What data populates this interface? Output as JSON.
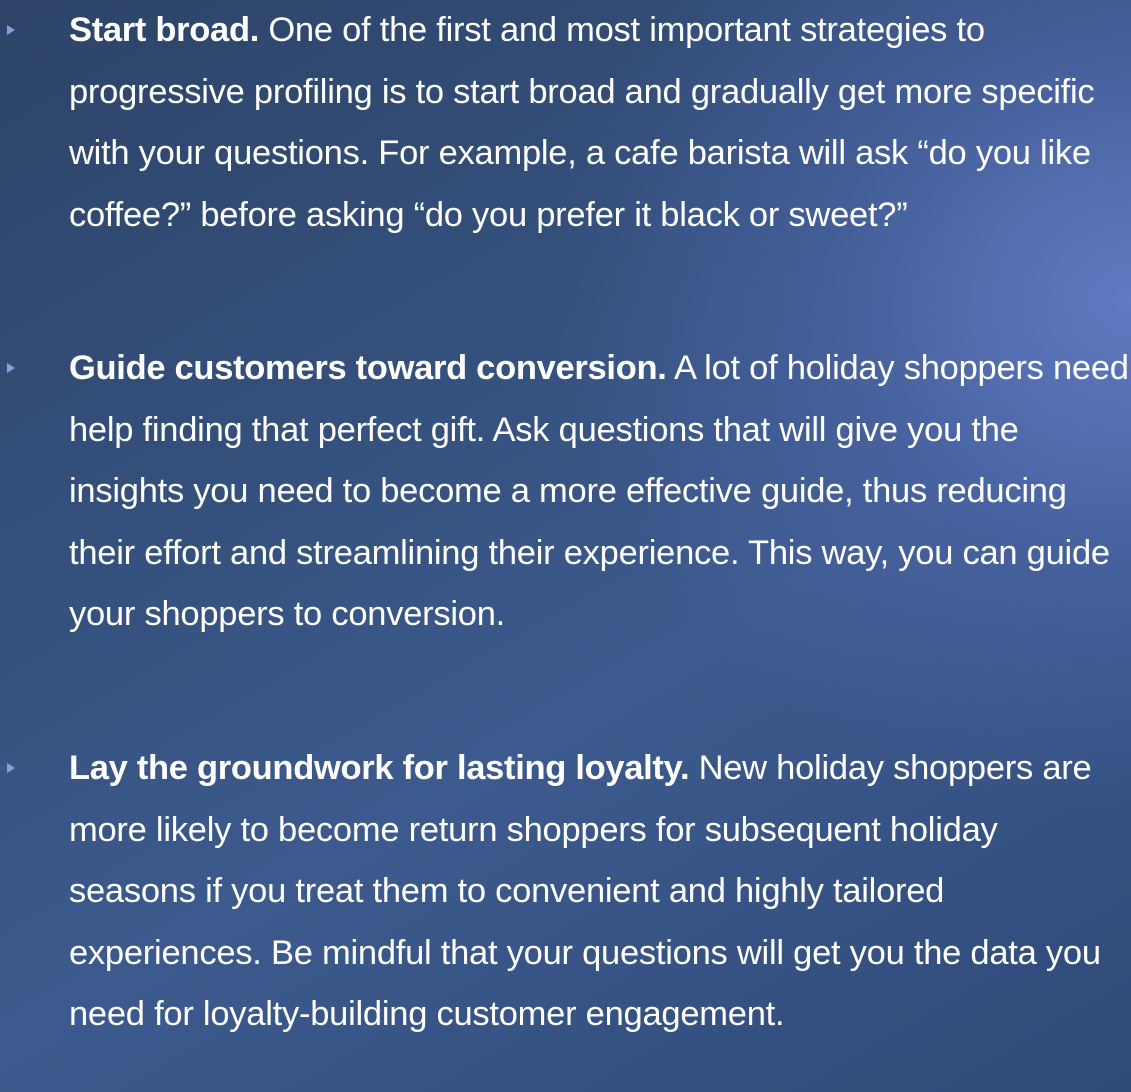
{
  "bullets": [
    {
      "lead": "Start broad.",
      "body": " One of the first and most important strategies to progressive profiling is to start broad and gradually get more specific with your questions. For example, a cafe barista will ask “do you like coffee?” before asking “do you prefer it black or sweet?”"
    },
    {
      "lead": "Guide customers toward conversion.",
      "body": " A lot of holiday shoppers need help finding that perfect gift. Ask questions that will give you the insights you need to become a more effective guide, thus reducing their effort and streamlining their experience. This way, you can guide your shoppers to conversion."
    },
    {
      "lead": "Lay the groundwork for lasting loyalty.",
      "body": " New holiday shoppers are more likely to become return shoppers for subsequent holiday seasons if you treat them to convenient and highly tailored experiences. Be mindful that your questions will get you the data you need for loyalty-building customer engagement."
    }
  ],
  "colors": {
    "text": "#ffffff",
    "marker": "#7fa2e2",
    "background_dark": "#2e4468",
    "background_light": "#627cc6"
  },
  "icons": {
    "marker": "triangle-bullet-icon"
  }
}
